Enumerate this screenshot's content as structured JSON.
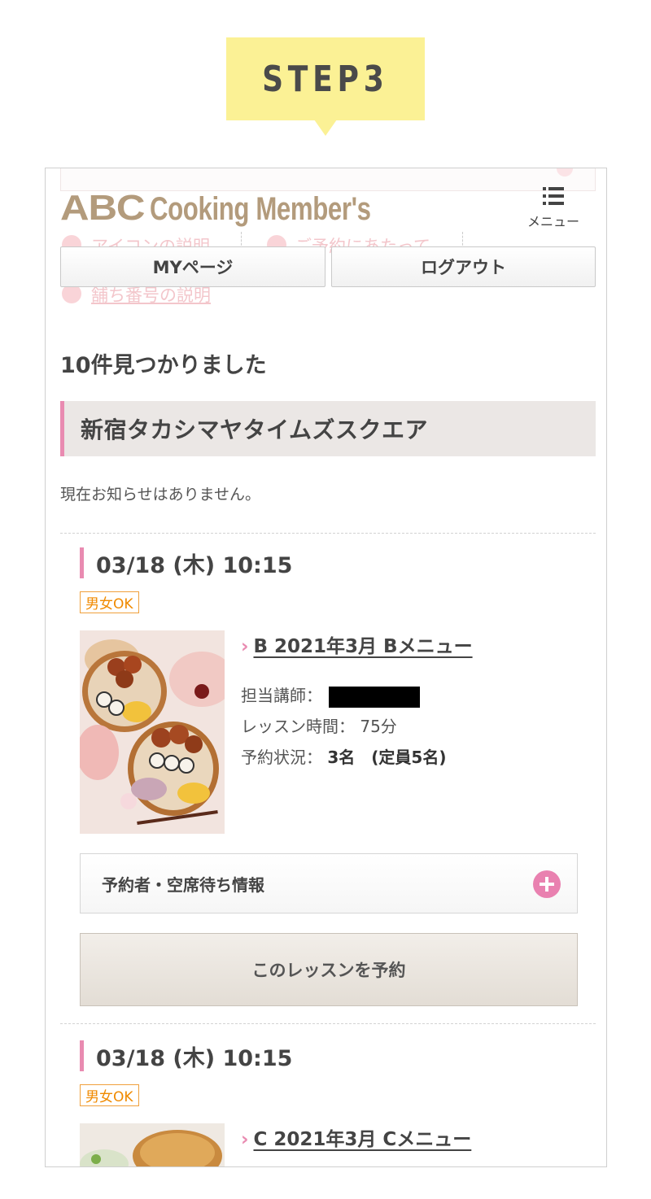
{
  "step": {
    "label": "STEP3"
  },
  "header": {
    "logo_abc": "ABC",
    "logo_text": "Cooking Member's",
    "menu_label": "メニュー",
    "ghost_links": [
      "アイコンの説明",
      "ご予約にあたって",
      "舗ち番号の説明"
    ]
  },
  "nav": {
    "mypage": "MYページ",
    "logout": "ログアウト"
  },
  "results": {
    "count_text": "10件見つかりました"
  },
  "shop": {
    "name": "新宿タカシマヤタイムズスクエア",
    "notice": "現在お知らせはありません。"
  },
  "lessons": [
    {
      "date": "03/18 (木) 10:15",
      "tag": "男女OK",
      "menu": "B 2021年3月 Bメニュー",
      "instructor_label": "担当講師：",
      "duration_label": "レッスン時間：",
      "duration_value": "75分",
      "status_label": "予約状況：",
      "status_value": "3名　(定員5名)",
      "waitlist_label": "予約者・空席待ち情報",
      "reserve_label": "このレッスンを予約"
    },
    {
      "date": "03/18 (木) 10:15",
      "tag": "男女OK",
      "menu": "C 2021年3月 Cメニュー"
    }
  ],
  "colors": {
    "accent_pink": "#e98bb1",
    "step_yellow": "#fbf195",
    "logo_brown": "#b39b7c",
    "tag_orange": "#f08a00"
  }
}
